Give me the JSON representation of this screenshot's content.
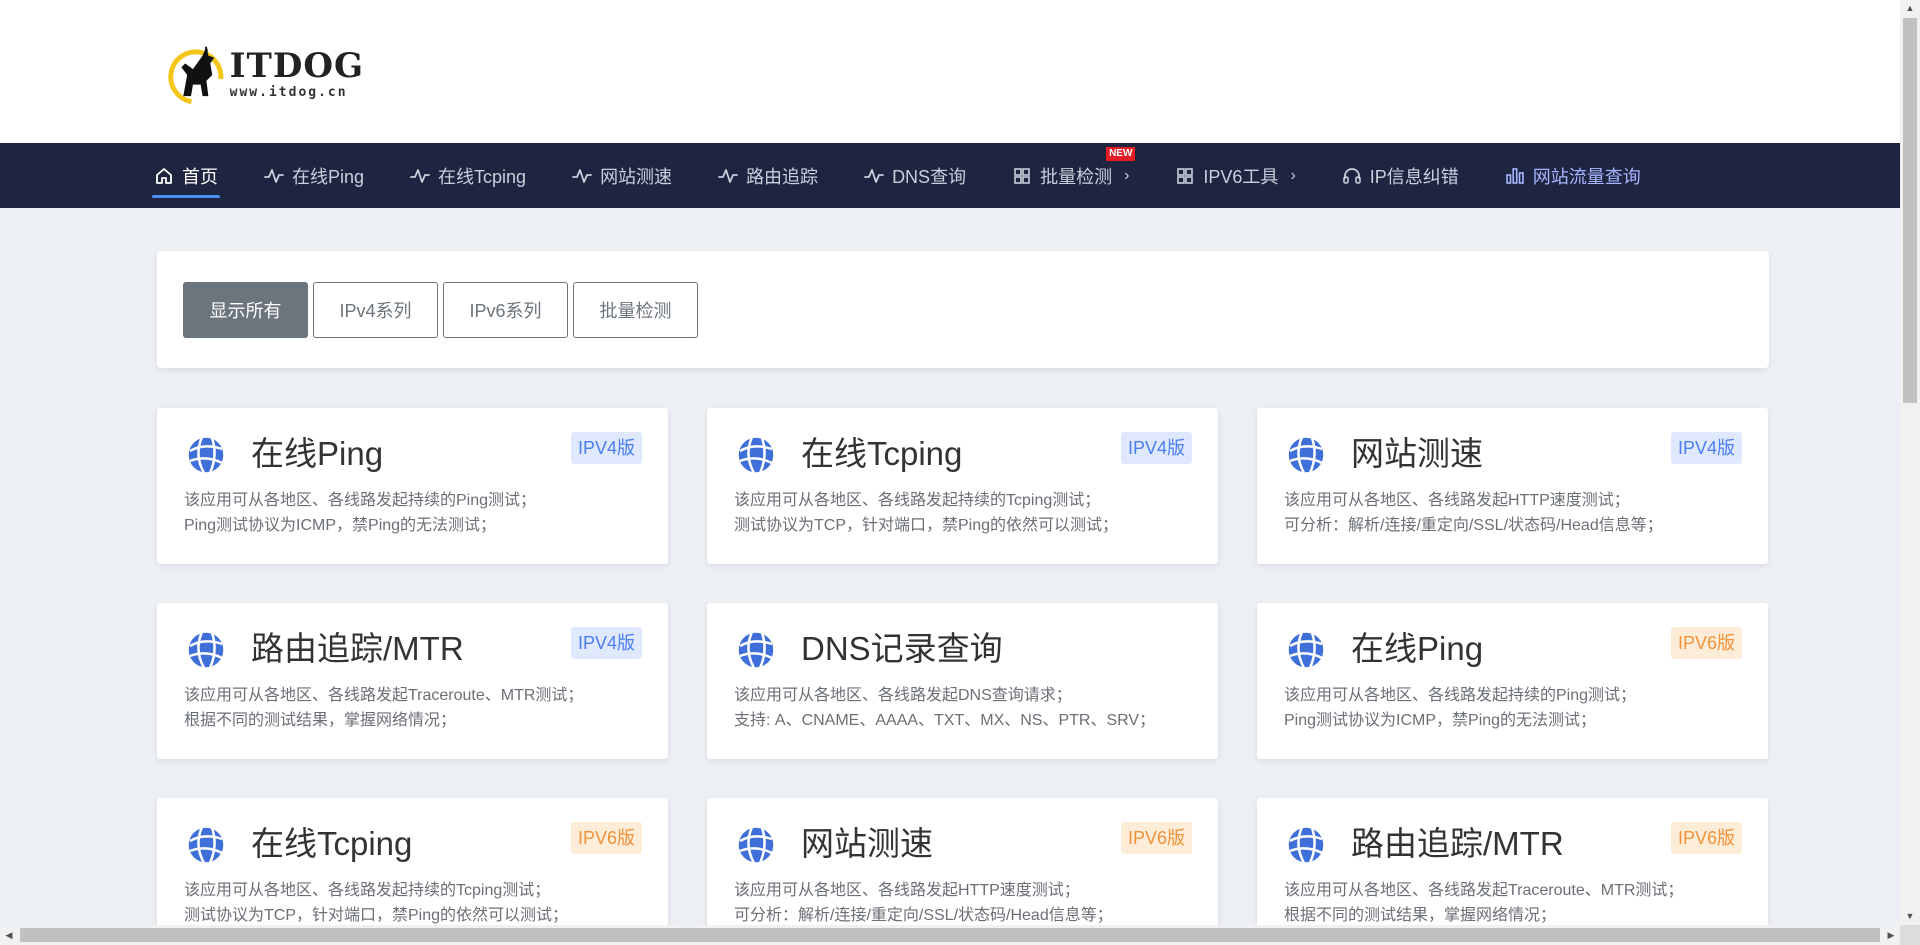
{
  "logo": {
    "title": "ITDOG",
    "url": "www.itdog.cn"
  },
  "nav": {
    "items": [
      {
        "label": "首页",
        "icon": "home-icon",
        "active": true
      },
      {
        "label": "在线Ping",
        "icon": "pulse-icon"
      },
      {
        "label": "在线Tcping",
        "icon": "pulse-icon"
      },
      {
        "label": "网站测速",
        "icon": "pulse-icon"
      },
      {
        "label": "路由追踪",
        "icon": "pulse-icon"
      },
      {
        "label": "DNS查询",
        "icon": "pulse-icon"
      },
      {
        "label": "批量检测",
        "icon": "grid-icon",
        "badge": "NEW",
        "dropdown": true
      },
      {
        "label": "IPV6工具",
        "icon": "grid-icon",
        "dropdown": true
      },
      {
        "label": "IP信息纠错",
        "icon": "headset-icon"
      },
      {
        "label": "网站流量查询",
        "icon": "bar-chart-icon",
        "accent": true
      }
    ]
  },
  "filters": [
    {
      "label": "显示所有",
      "active": true
    },
    {
      "label": "IPv4系列"
    },
    {
      "label": "IPv6系列"
    },
    {
      "label": "批量检测"
    }
  ],
  "cards": [
    {
      "title": "在线Ping",
      "badge": "IPV4版",
      "version": "v4",
      "desc": [
        "该应用可从各地区、各线路发起持续的Ping测试；",
        "Ping测试协议为ICMP，禁Ping的无法测试；"
      ]
    },
    {
      "title": "在线Tcping",
      "badge": "IPV4版",
      "version": "v4",
      "desc": [
        "该应用可从各地区、各线路发起持续的Tcping测试；",
        "测试协议为TCP，针对端口，禁Ping的依然可以测试；"
      ]
    },
    {
      "title": "网站测速",
      "badge": "IPV4版",
      "version": "v4",
      "desc": [
        "该应用可从各地区、各线路发起HTTP速度测试；",
        "可分析：解析/连接/重定向/SSL/状态码/Head信息等；"
      ]
    },
    {
      "title": "路由追踪/MTR",
      "badge": "IPV4版",
      "version": "v4",
      "desc": [
        "该应用可从各地区、各线路发起Traceroute、MTR测试；",
        "根据不同的测试结果，掌握网络情况；"
      ]
    },
    {
      "title": "DNS记录查询",
      "badge": "",
      "version": "",
      "desc": [
        "该应用可从各地区、各线路发起DNS查询请求；",
        "支持: A、CNAME、AAAA、TXT、MX、NS、PTR、SRV；"
      ]
    },
    {
      "title": "在线Ping",
      "badge": "IPV6版",
      "version": "v6",
      "desc": [
        "该应用可从各地区、各线路发起持续的Ping测试；",
        "Ping测试协议为ICMP，禁Ping的无法测试；"
      ]
    },
    {
      "title": "在线Tcping",
      "badge": "IPV6版",
      "version": "v6",
      "desc": [
        "该应用可从各地区、各线路发起持续的Tcping测试；",
        "测试协议为TCP，针对端口，禁Ping的依然可以测试；"
      ]
    },
    {
      "title": "网站测速",
      "badge": "IPV6版",
      "version": "v6",
      "desc": [
        "该应用可从各地区、各线路发起HTTP速度测试；",
        "可分析：解析/连接/重定向/SSL/状态码/Head信息等；"
      ]
    },
    {
      "title": "路由追踪/MTR",
      "badge": "IPV6版",
      "version": "v6",
      "desc": [
        "该应用可从各地区、各线路发起Traceroute、MTR测试；",
        "根据不同的测试结果，掌握网络情况；"
      ]
    }
  ],
  "colors": {
    "nav_bg": "#1d2540",
    "accent": "#4f8ef7",
    "ipv4_badge": "#4b7ff0",
    "ipv6_badge": "#f0933a",
    "card_icon": "#3f6fd8"
  }
}
